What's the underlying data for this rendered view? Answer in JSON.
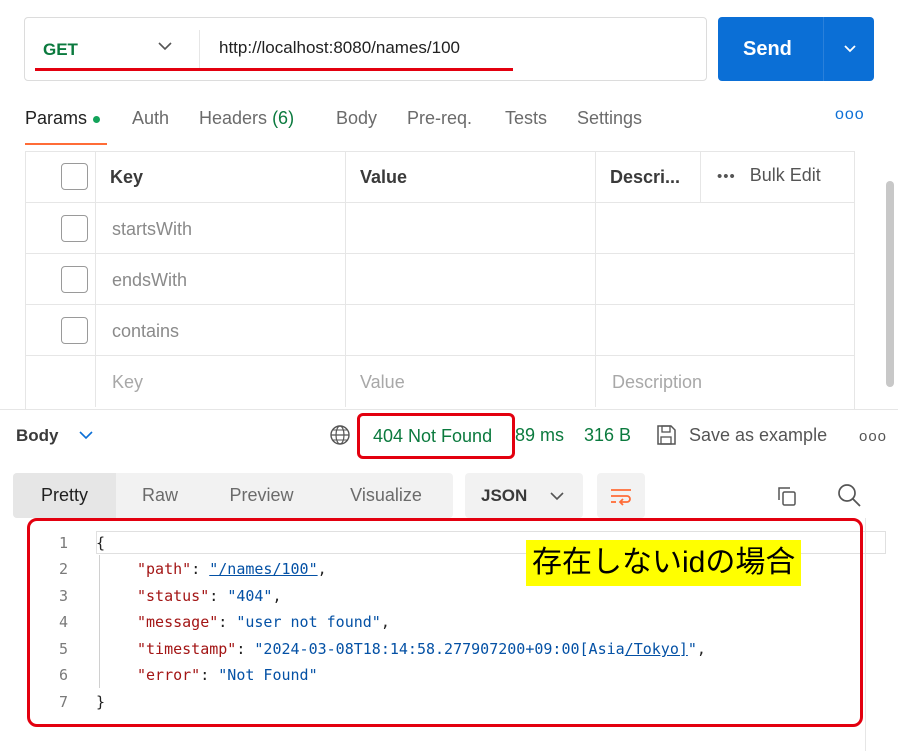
{
  "request": {
    "method": "GET",
    "url": "http://localhost:8080/names/100",
    "send_label": "Send"
  },
  "request_tabs": {
    "params": "Params",
    "auth": "Auth",
    "headers": "Headers",
    "headers_count": "(6)",
    "body": "Body",
    "prereq": "Pre-req.",
    "tests": "Tests",
    "settings": "Settings",
    "more": "ooo"
  },
  "params_table": {
    "columns": {
      "key": "Key",
      "value": "Value",
      "description": "Descri...",
      "bulk_edit": "Bulk Edit",
      "bulk_dots": "•••"
    },
    "rows": [
      {
        "key": "startsWith",
        "value": "",
        "description": ""
      },
      {
        "key": "endsWith",
        "value": "",
        "description": ""
      },
      {
        "key": "contains",
        "value": "",
        "description": ""
      }
    ],
    "placeholders": {
      "key": "Key",
      "value": "Value",
      "description": "Description"
    }
  },
  "response": {
    "body_label": "Body",
    "status": "404 Not Found",
    "time": "89 ms",
    "size": "316 B",
    "save_label": "Save as example",
    "more": "ooo",
    "view_tabs": [
      "Pretty",
      "Raw",
      "Preview",
      "Visualize"
    ],
    "format": "JSON",
    "line_numbers": [
      "1",
      "2",
      "3",
      "4",
      "5",
      "6",
      "7"
    ],
    "json": {
      "open": "{",
      "close": "}",
      "path_key": "\"path\"",
      "path_val": "\"/names/100\"",
      "status_key": "\"status\"",
      "status_val": "\"404\"",
      "message_key": "\"message\"",
      "message_val": "\"user not found\"",
      "timestamp_key": "\"timestamp\"",
      "timestamp_val_a": "\"2024-03-08T18:14:58.277907200+09:00[Asia",
      "timestamp_val_b": "/Tokyo]",
      "timestamp_val_c": "\"",
      "error_key": "\"error\"",
      "error_val": "\"Not Found\""
    }
  },
  "annotation": "存在しないidの場合",
  "colors": {
    "method": "#0b7a3e",
    "send": "#0b6fd6",
    "status_ok_text": "#0b7a3e",
    "highlight_outline": "#e3000f",
    "annotation_bg": "#ffff00",
    "json_key": "#a31515",
    "json_string": "#0451a5"
  }
}
